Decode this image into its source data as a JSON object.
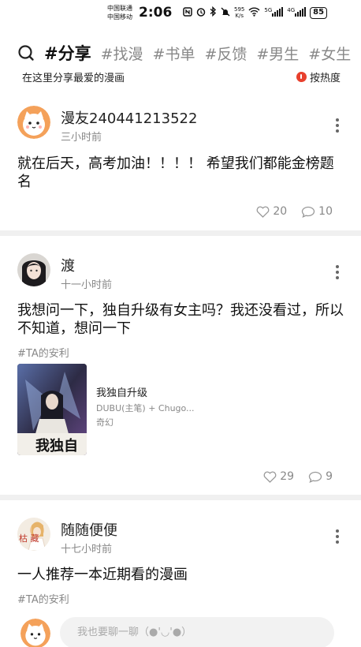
{
  "status_bar": {
    "carrier1": "中国联通",
    "carrier2": "中国移动",
    "time": "2:06",
    "netspeed_value": "595",
    "netspeed_unit": "K/s",
    "battery": "85"
  },
  "tabs": {
    "search_icon": "search-icon",
    "items": [
      "#分享",
      "#找漫",
      "#书单",
      "#反馈",
      "#男生",
      "#女生",
      "#"
    ]
  },
  "header": {
    "subtitle": "在这里分享最爱的漫画",
    "sort_label": "按热度"
  },
  "posts": [
    {
      "username": "漫友240441213522",
      "time": "三小时前",
      "content": "就在后天，高考加油！！！！ 希望我们都能金榜题名",
      "likes": "20",
      "comments": "10"
    },
    {
      "username": "渡",
      "time": "十一小时前",
      "content": "我想问一下，独自升级有女主吗？我还没看过，所以不知道，想问一下",
      "tag": "#TA的安利",
      "comic": {
        "title": "我独自升级",
        "author": "DUBU(主笔) + Chugo...",
        "genre": "奇幻",
        "cover_text": "我独自"
      },
      "likes": "29",
      "comments": "9"
    },
    {
      "username": "随随便便",
      "time": "十七小时前",
      "content": "一人推荐一本近期看的漫画",
      "tag": "#TA的安利",
      "avatar_text": "枯 藏"
    }
  ],
  "comment_bar": {
    "placeholder": "我也要聊一聊（●'◡'●）"
  }
}
